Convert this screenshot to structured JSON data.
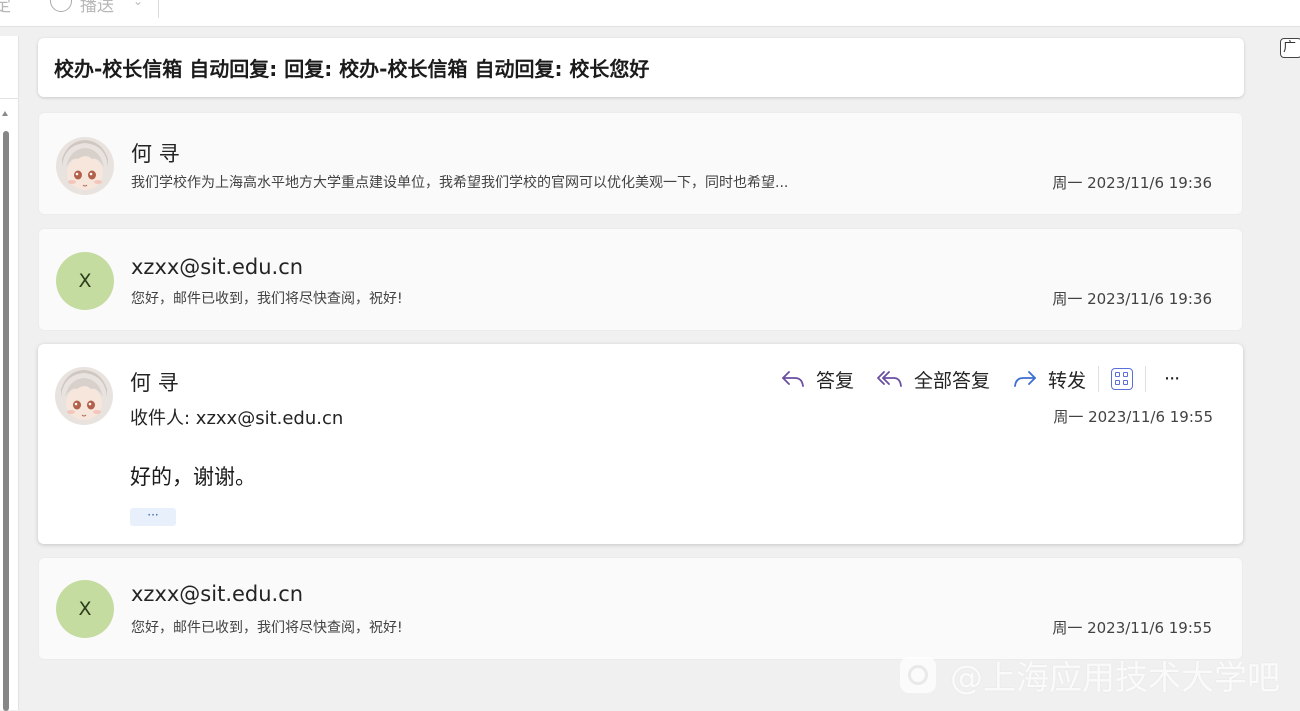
{
  "ribbon": {
    "fragment_left": "定",
    "fragment_right": "播送"
  },
  "thread": {
    "subject": "校办-校长信箱 自动回复: 回复: 校办-校长信箱 自动回复: 校长您好",
    "messages": [
      {
        "sender": "何 寻",
        "avatar": "anime-avatar",
        "preview": "我们学校作为上海高水平地方大学重点建设单位，我希望我们学校的官网可以优化美观一下，同时也希望...",
        "date": "周一 2023/11/6 19:36"
      },
      {
        "sender": "xzxx@sit.edu.cn",
        "avatar_letter": "X",
        "preview": "您好，邮件已收到，我们将尽快查阅，祝好!",
        "date": "周一 2023/11/6 19:36"
      },
      {
        "sender": "何 寻",
        "avatar": "anime-avatar",
        "to": "收件人: xzxx@sit.edu.cn",
        "date": "周一 2023/11/6 19:55",
        "body": "好的，谢谢。",
        "show_more": "···",
        "actions": {
          "reply": "答复",
          "reply_all": "全部答复",
          "forward": "转发",
          "apps_icon": "apps-icon",
          "more": "···"
        }
      },
      {
        "sender": "xzxx@sit.edu.cn",
        "avatar_letter": "X",
        "preview": "您好，邮件已收到，我们将尽快查阅，祝好!",
        "date": "周一 2023/11/6 19:55"
      }
    ]
  },
  "corner_label": "广",
  "watermark": "@上海应用技术大学吧",
  "colors": {
    "letter_avatar_bg": "#c5dca0",
    "reply_icon": "#6b4fa0",
    "forward_icon": "#3b6fd1",
    "apps_icon": "#5b6fd8"
  }
}
